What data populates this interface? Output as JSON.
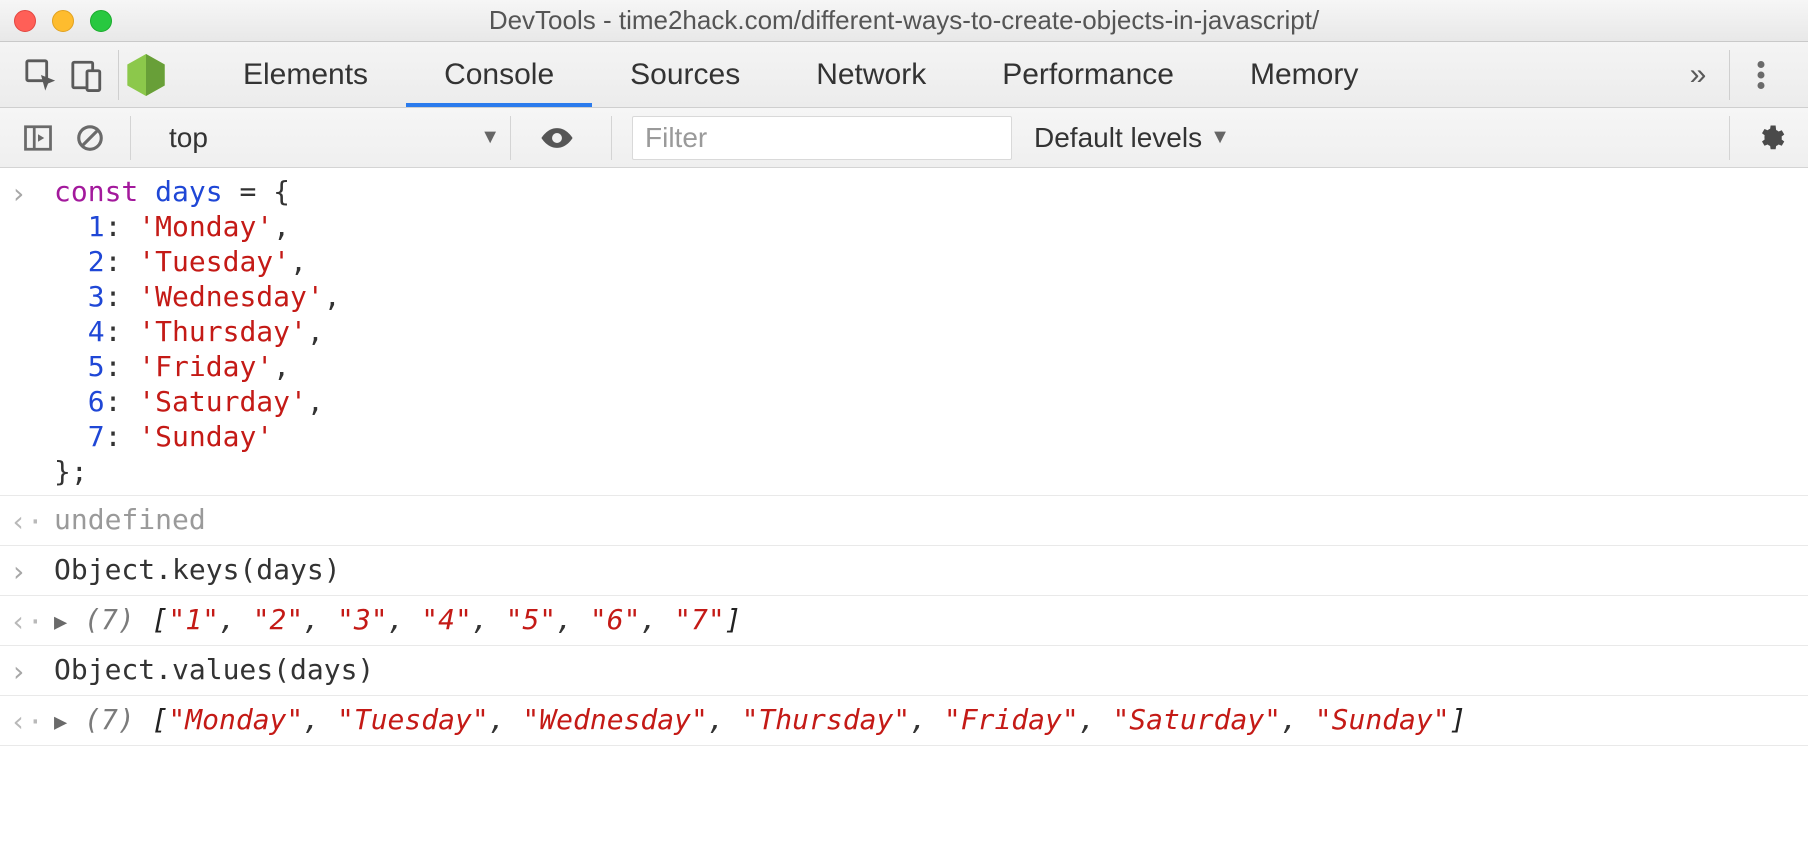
{
  "window": {
    "title": "DevTools - time2hack.com/different-ways-to-create-objects-in-javascript/"
  },
  "tabs": {
    "items": [
      "Elements",
      "Console",
      "Sources",
      "Network",
      "Performance",
      "Memory"
    ],
    "active_index": 1,
    "overflow_glyph": "»"
  },
  "toolbar": {
    "context": "top",
    "filter_placeholder": "Filter",
    "levels_label": "Default levels",
    "triangle": "▼"
  },
  "console_entries": [
    {
      "type": "input",
      "keyword": "const",
      "identifier": "days",
      "assign_open": " = {",
      "lines": [
        {
          "key": "1",
          "value": "'Monday'",
          "comma": ","
        },
        {
          "key": "2",
          "value": "'Tuesday'",
          "comma": ","
        },
        {
          "key": "3",
          "value": "'Wednesday'",
          "comma": ","
        },
        {
          "key": "4",
          "value": "'Thursday'",
          "comma": ","
        },
        {
          "key": "5",
          "value": "'Friday'",
          "comma": ","
        },
        {
          "key": "6",
          "value": "'Saturday'",
          "comma": ","
        },
        {
          "key": "7",
          "value": "'Sunday'",
          "comma": ""
        }
      ],
      "close": "};"
    },
    {
      "type": "output_undefined",
      "text": "undefined"
    },
    {
      "type": "input_plain",
      "text": "Object.keys(days)"
    },
    {
      "type": "output_array",
      "count": "(7)",
      "open": " [",
      "items": [
        "\"1\"",
        "\"2\"",
        "\"3\"",
        "\"4\"",
        "\"5\"",
        "\"6\"",
        "\"7\""
      ],
      "sep": ", ",
      "close": "]"
    },
    {
      "type": "input_plain",
      "text": "Object.values(days)"
    },
    {
      "type": "output_array",
      "count": "(7)",
      "open": " [",
      "items": [
        "\"Monday\"",
        "\"Tuesday\"",
        "\"Wednesday\"",
        "\"Thursday\"",
        "\"Friday\"",
        "\"Saturday\"",
        "\"Sunday\""
      ],
      "sep": ", ",
      "close": "]"
    }
  ],
  "glyphs": {
    "input_prompt": "›",
    "output_prompt": "‹·",
    "disclose": "▶"
  }
}
